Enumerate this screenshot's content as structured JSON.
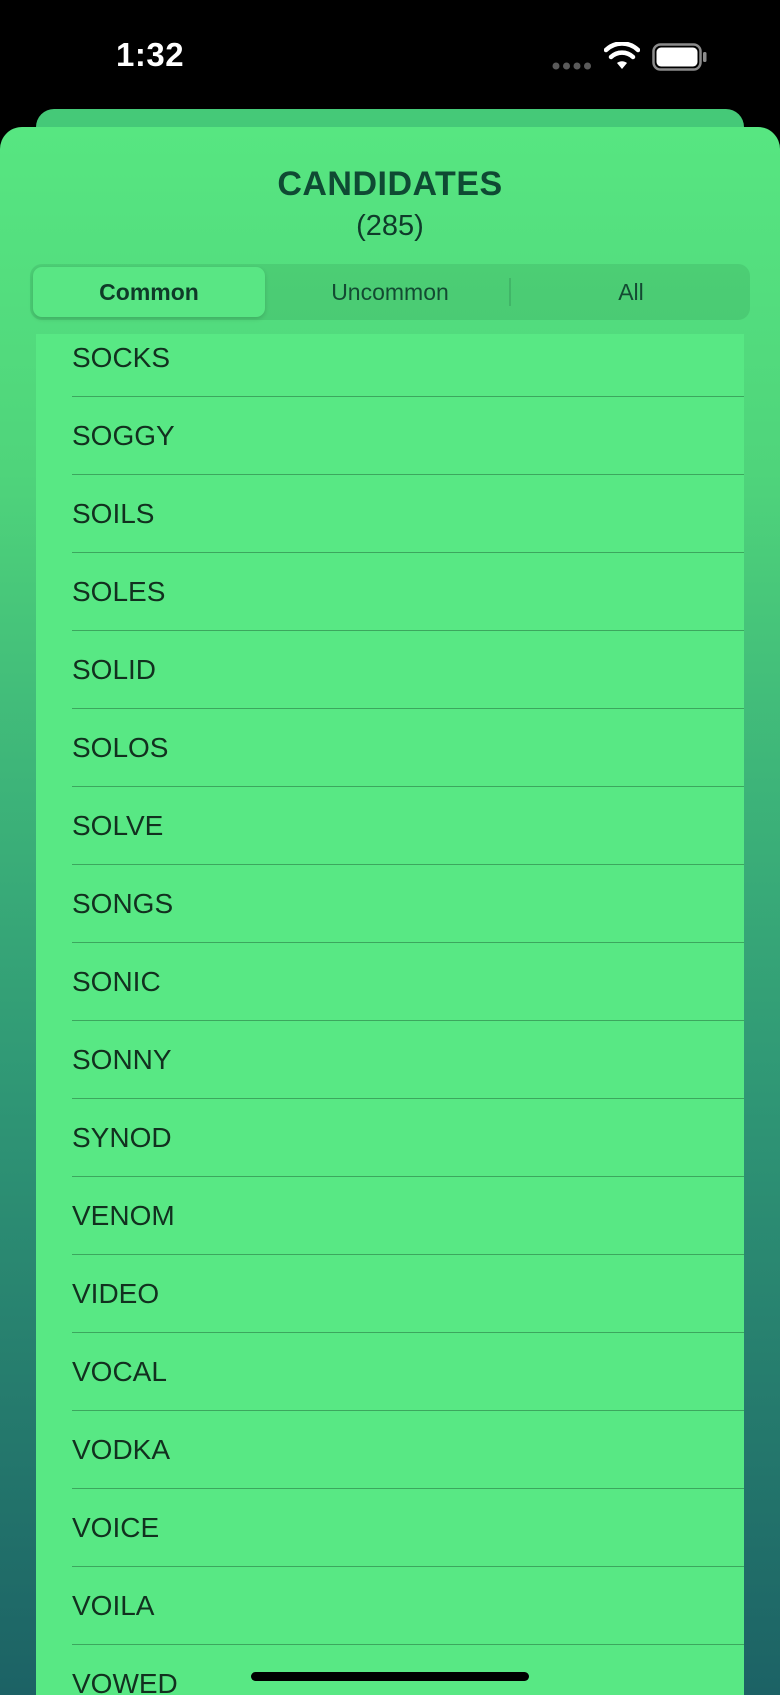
{
  "status_bar": {
    "time": "1:32"
  },
  "sheet": {
    "title": "CANDIDATES",
    "count": "(285)",
    "tabs": [
      {
        "label": "Common",
        "selected": true
      },
      {
        "label": "Uncommon",
        "selected": false
      },
      {
        "label": "All",
        "selected": false
      }
    ],
    "candidates": [
      "SOCKS",
      "SOGGY",
      "SOILS",
      "SOLES",
      "SOLID",
      "SOLOS",
      "SOLVE",
      "SONGS",
      "SONIC",
      "SONNY",
      "SYNOD",
      "VENOM",
      "VIDEO",
      "VOCAL",
      "VODKA",
      "VOICE",
      "VOILA",
      "VOWED"
    ]
  },
  "colors": {
    "list_background": "#58e884",
    "title_text": "#0f4a33",
    "gradient_top": "#57e681",
    "gradient_bottom": "#1c6265"
  }
}
